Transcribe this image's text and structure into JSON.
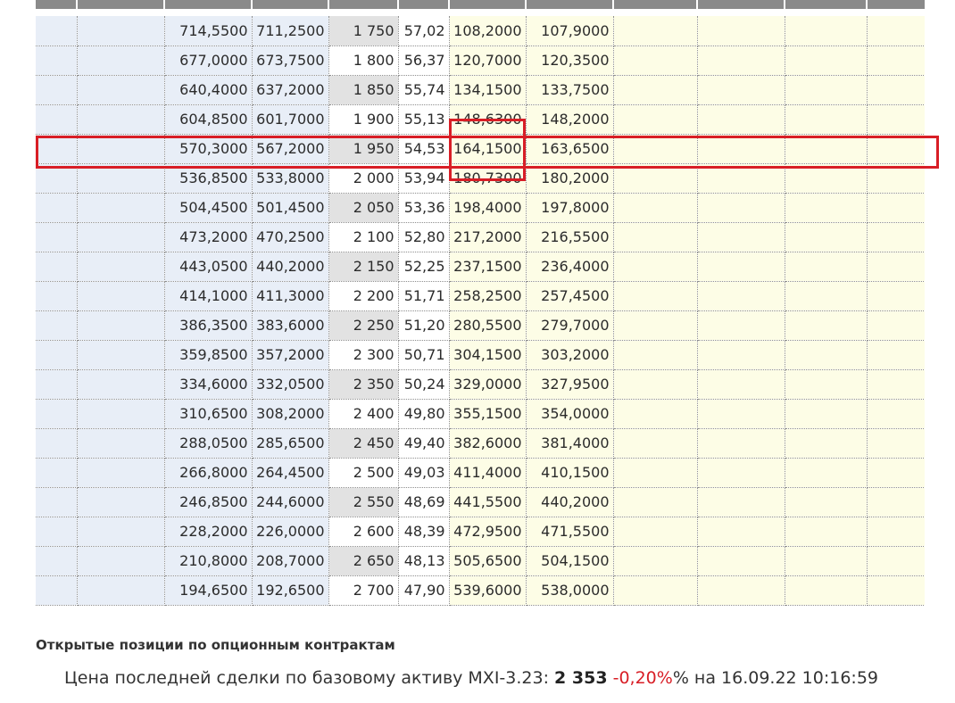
{
  "table": {
    "rows": [
      {
        "c2": "714,5500",
        "c3": "711,2500",
        "strike": "1 750",
        "iv": "57,02",
        "c6": "108,2000",
        "c7": "107,9000"
      },
      {
        "c2": "677,0000",
        "c3": "673,7500",
        "strike": "1 800",
        "iv": "56,37",
        "c6": "120,7000",
        "c7": "120,3500"
      },
      {
        "c2": "640,4000",
        "c3": "637,2000",
        "strike": "1 850",
        "iv": "55,74",
        "c6": "134,1500",
        "c7": "133,7500"
      },
      {
        "c2": "604,8500",
        "c3": "601,7000",
        "strike": "1 900",
        "iv": "55,13",
        "c6": "148,6300",
        "c7": "148,2000"
      },
      {
        "c2": "570,3000",
        "c3": "567,2000",
        "strike": "1 950",
        "iv": "54,53",
        "c6": "164,1500",
        "c7": "163,6500"
      },
      {
        "c2": "536,8500",
        "c3": "533,8000",
        "strike": "2 000",
        "iv": "53,94",
        "c6": "180,7300",
        "c7": "180,2000"
      },
      {
        "c2": "504,4500",
        "c3": "501,4500",
        "strike": "2 050",
        "iv": "53,36",
        "c6": "198,4000",
        "c7": "197,8000"
      },
      {
        "c2": "473,2000",
        "c3": "470,2500",
        "strike": "2 100",
        "iv": "52,80",
        "c6": "217,2000",
        "c7": "216,5500"
      },
      {
        "c2": "443,0500",
        "c3": "440,2000",
        "strike": "2 150",
        "iv": "52,25",
        "c6": "237,1500",
        "c7": "236,4000"
      },
      {
        "c2": "414,1000",
        "c3": "411,3000",
        "strike": "2 200",
        "iv": "51,71",
        "c6": "258,2500",
        "c7": "257,4500"
      },
      {
        "c2": "386,3500",
        "c3": "383,6000",
        "strike": "2 250",
        "iv": "51,20",
        "c6": "280,5500",
        "c7": "279,7000"
      },
      {
        "c2": "359,8500",
        "c3": "357,2000",
        "strike": "2 300",
        "iv": "50,71",
        "c6": "304,1500",
        "c7": "303,2000"
      },
      {
        "c2": "334,6000",
        "c3": "332,0500",
        "strike": "2 350",
        "iv": "50,24",
        "c6": "329,0000",
        "c7": "327,9500"
      },
      {
        "c2": "310,6500",
        "c3": "308,2000",
        "strike": "2 400",
        "iv": "49,80",
        "c6": "355,1500",
        "c7": "354,0000"
      },
      {
        "c2": "288,0500",
        "c3": "285,6500",
        "strike": "2 450",
        "iv": "49,40",
        "c6": "382,6000",
        "c7": "381,4000"
      },
      {
        "c2": "266,8000",
        "c3": "264,4500",
        "strike": "2 500",
        "iv": "49,03",
        "c6": "411,4000",
        "c7": "410,1500"
      },
      {
        "c2": "246,8500",
        "c3": "244,6000",
        "strike": "2 550",
        "iv": "48,69",
        "c6": "441,5500",
        "c7": "440,2000"
      },
      {
        "c2": "228,2000",
        "c3": "226,0000",
        "strike": "2 600",
        "iv": "48,39",
        "c6": "472,9500",
        "c7": "471,5500"
      },
      {
        "c2": "210,8000",
        "c3": "208,7000",
        "strike": "2 650",
        "iv": "48,13",
        "c6": "505,6500",
        "c7": "504,1500"
      },
      {
        "c2": "194,6500",
        "c3": "192,6500",
        "strike": "2 700",
        "iv": "47,90",
        "c6": "539,6000",
        "c7": "538,0000"
      }
    ]
  },
  "section": {
    "title": "Открытые позиции по опционным контрактам"
  },
  "price": {
    "prefix": "Цена последней сделки по базовому активу MXI-3.23:",
    "value": "2 353",
    "change": "-0,20%",
    "suffix": "% на 16.09.22 10:16:59"
  },
  "colors": {
    "highlight": "#d81e26",
    "put_bg": "#fdfde6",
    "call_bg": "#e8eef7",
    "strike_shade": "#e2e2e2"
  }
}
